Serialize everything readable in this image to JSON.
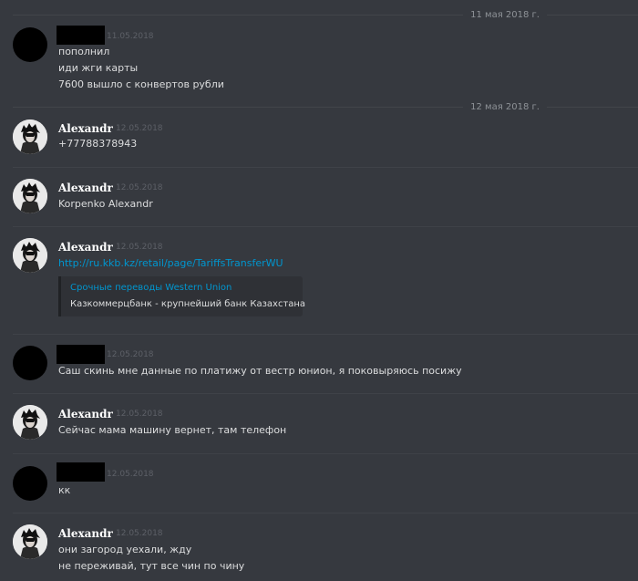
{
  "dividers": [
    "11 мая 2018 г.",
    "12 мая 2018 г."
  ],
  "messages": [
    {
      "author": "",
      "timestamp": "11.05.2018",
      "lines": [
        "пополнил",
        "иди жги карты",
        "7600 вышло с конвертов рубли"
      ]
    },
    {
      "author": "Alexandr",
      "timestamp": "12.05.2018",
      "lines": [
        "+77788378943"
      ]
    },
    {
      "author": "Alexandr",
      "timestamp": "12.05.2018",
      "lines": [
        "Korpenko Alexandr"
      ]
    },
    {
      "author": "Alexandr",
      "timestamp": "12.05.2018",
      "link": "http://ru.kkb.kz/retail/page/TariffsTransferWU",
      "embed": {
        "title": "Срочные переводы Western Union",
        "description": "Казкоммерцбанк - крупнейший банк Казахстана"
      }
    },
    {
      "author": "",
      "timestamp": "12.05.2018",
      "lines": [
        "Саш скинь мне данные по платижу от вестр юнион, я поковыряюсь посижу"
      ]
    },
    {
      "author": "Alexandr",
      "timestamp": "12.05.2018",
      "lines": [
        "Сейчас мама машину вернет, там телефон"
      ]
    },
    {
      "author": "",
      "timestamp": "12.05.2018",
      "lines": [
        "кк"
      ]
    },
    {
      "author": "Alexandr",
      "timestamp": "12.05.2018",
      "lines": [
        "они загород уехали, жду",
        "не переживай, тут все чин по чину"
      ]
    }
  ]
}
